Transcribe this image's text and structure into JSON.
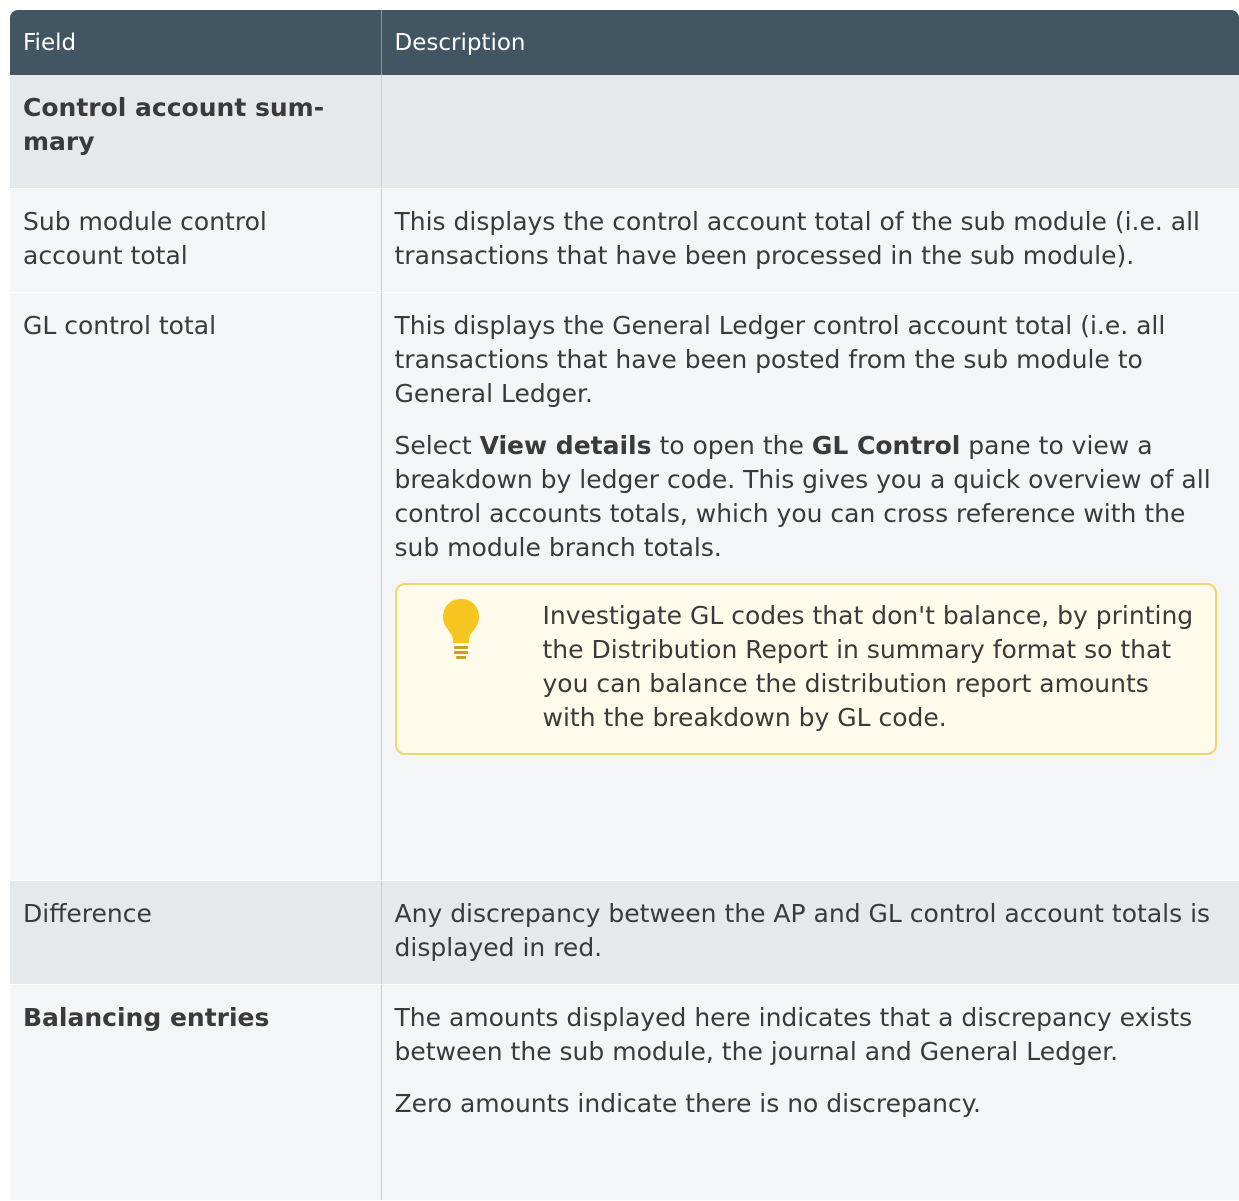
{
  "table": {
    "headers": [
      "Field",
      "Description"
    ],
    "rows": {
      "control_summary": {
        "field": "Control account sum-\nmary"
      },
      "sub_module_total": {
        "field_line1": "Sub module control",
        "field_line2": "account total",
        "desc": "This displays the control account total of the sub module (i.e. all transactions that have been processed in the sub module)."
      },
      "gl_control_total": {
        "field": "GL control total",
        "desc1": "This displays the General Ledger control account total (i.e. all transactions that have been posted from the sub module to General Ledger.",
        "desc2_pre": "Select ",
        "desc2_bold1": "View details",
        "desc2_mid": " to open the ",
        "desc2_bold2": "GL Control",
        "desc2_post": " pane to view a breakdown by ledger code. This gives you a quick overview of all control accounts totals, which you can cross reference with the sub module branch totals.",
        "tip": "Investigate GL codes that don't balance, by printing the Distribution Report in summary format so that you can balance the distribution report amounts with the breakdown by GL code.",
        "tip_icon": "lightbulb-icon",
        "tip_border_color": "#f2d46c",
        "tip_bg_color": "#fffbea"
      },
      "difference": {
        "field": "Difference",
        "desc": "Any discrepancy between the AP and GL control account totals is displayed in red."
      },
      "balancing_entries": {
        "field": "Balancing entries",
        "desc1": "The amounts displayed here indicates that a discrepancy exists between the sub module, the journal and General Ledger.",
        "desc2": "Zero amounts indicate there is no discrepancy."
      }
    }
  },
  "colors": {
    "header_bg": "#425563",
    "row_shade": "#e6e9ec",
    "row_plain": "#f4f5f6"
  }
}
